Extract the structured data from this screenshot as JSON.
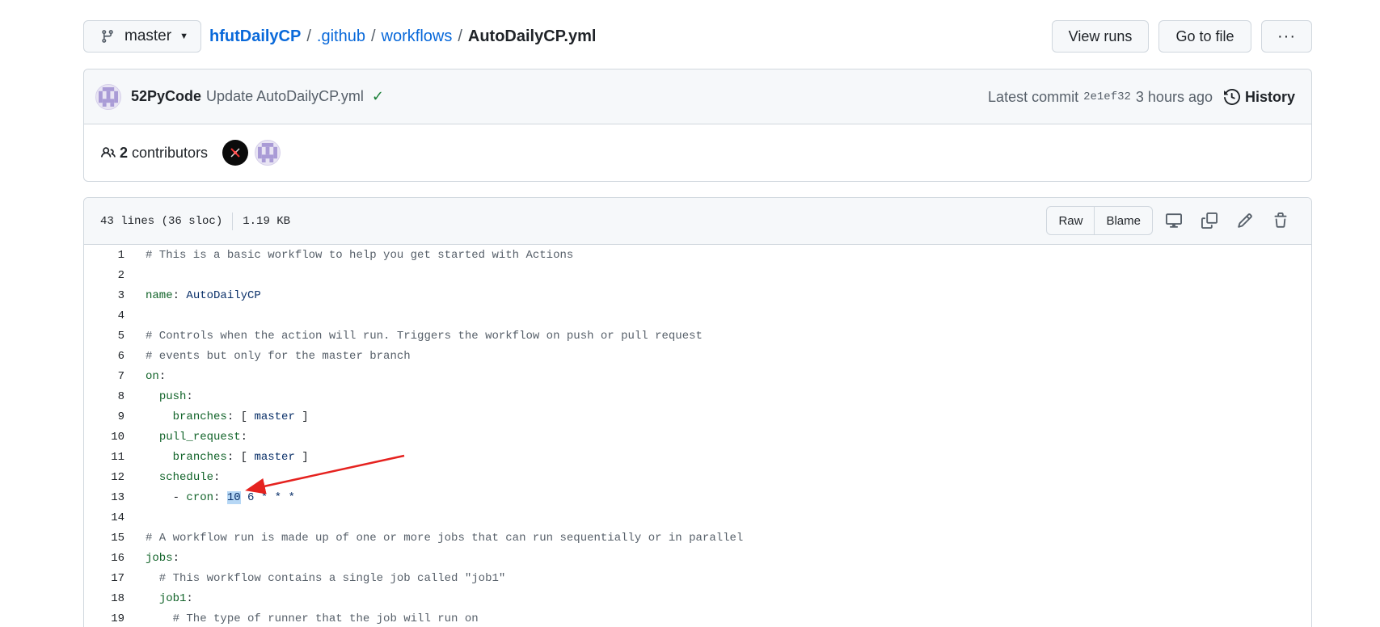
{
  "topbar": {
    "branch": "master",
    "breadcrumb": {
      "repo": "hfutDailyCP",
      "path1": ".github",
      "path2": "workflows",
      "file": "AutoDailyCP.yml",
      "separator": "/"
    },
    "view_runs": "View runs",
    "go_to_file": "Go to file",
    "more": "···"
  },
  "commit": {
    "author": "52PyCode",
    "message": "Update AutoDailyCP.yml",
    "status": "✓",
    "latest_label": "Latest commit",
    "sha": "2e1ef32",
    "time": "3 hours ago",
    "history": "History"
  },
  "contributors": {
    "count": "2",
    "label": "contributors"
  },
  "file": {
    "lines_info": "43 lines (36 sloc)",
    "size": "1.19 KB",
    "raw": "Raw",
    "blame": "Blame"
  },
  "code": [
    {
      "n": "1",
      "parts": [
        {
          "t": "# This is a basic workflow to help you get started with Actions",
          "c": "c-comment"
        }
      ]
    },
    {
      "n": "2",
      "parts": []
    },
    {
      "n": "3",
      "parts": [
        {
          "t": "name",
          "c": "c-key"
        },
        {
          "t": ": ",
          "c": "c-plain"
        },
        {
          "t": "AutoDailyCP",
          "c": "c-val"
        }
      ]
    },
    {
      "n": "4",
      "parts": []
    },
    {
      "n": "5",
      "parts": [
        {
          "t": "# Controls when the action will run. Triggers the workflow on push or pull request",
          "c": "c-comment"
        }
      ]
    },
    {
      "n": "6",
      "parts": [
        {
          "t": "# events but only for the master branch",
          "c": "c-comment"
        }
      ]
    },
    {
      "n": "7",
      "parts": [
        {
          "t": "on",
          "c": "c-key"
        },
        {
          "t": ":",
          "c": "c-plain"
        }
      ]
    },
    {
      "n": "8",
      "parts": [
        {
          "t": "  ",
          "c": "c-plain"
        },
        {
          "t": "push",
          "c": "c-key"
        },
        {
          "t": ":",
          "c": "c-plain"
        }
      ]
    },
    {
      "n": "9",
      "parts": [
        {
          "t": "    ",
          "c": "c-plain"
        },
        {
          "t": "branches",
          "c": "c-key"
        },
        {
          "t": ": [ ",
          "c": "c-plain"
        },
        {
          "t": "master",
          "c": "c-val"
        },
        {
          "t": " ]",
          "c": "c-plain"
        }
      ]
    },
    {
      "n": "10",
      "parts": [
        {
          "t": "  ",
          "c": "c-plain"
        },
        {
          "t": "pull_request",
          "c": "c-key"
        },
        {
          "t": ":",
          "c": "c-plain"
        }
      ]
    },
    {
      "n": "11",
      "parts": [
        {
          "t": "    ",
          "c": "c-plain"
        },
        {
          "t": "branches",
          "c": "c-key"
        },
        {
          "t": ": [ ",
          "c": "c-plain"
        },
        {
          "t": "master",
          "c": "c-val"
        },
        {
          "t": " ]",
          "c": "c-plain"
        }
      ]
    },
    {
      "n": "12",
      "parts": [
        {
          "t": "  ",
          "c": "c-plain"
        },
        {
          "t": "schedule",
          "c": "c-key"
        },
        {
          "t": ":",
          "c": "c-plain"
        }
      ]
    },
    {
      "n": "13",
      "parts": [
        {
          "t": "    - ",
          "c": "c-plain"
        },
        {
          "t": "cron",
          "c": "c-key"
        },
        {
          "t": ": ",
          "c": "c-plain"
        },
        {
          "t": "10",
          "c": "c-val sel"
        },
        {
          "t": " 6 * * *",
          "c": "c-val"
        }
      ]
    },
    {
      "n": "14",
      "parts": []
    },
    {
      "n": "15",
      "parts": [
        {
          "t": "# A workflow run is made up of one or more jobs that can run sequentially or in parallel",
          "c": "c-comment"
        }
      ]
    },
    {
      "n": "16",
      "parts": [
        {
          "t": "jobs",
          "c": "c-key"
        },
        {
          "t": ":",
          "c": "c-plain"
        }
      ]
    },
    {
      "n": "17",
      "parts": [
        {
          "t": "  # This workflow contains a single job called \"job1\"",
          "c": "c-comment"
        }
      ]
    },
    {
      "n": "18",
      "parts": [
        {
          "t": "  ",
          "c": "c-plain"
        },
        {
          "t": "job1",
          "c": "c-key"
        },
        {
          "t": ":",
          "c": "c-plain"
        }
      ]
    },
    {
      "n": "19",
      "parts": [
        {
          "t": "    # The type of runner that the job will run on",
          "c": "c-comment"
        }
      ]
    }
  ],
  "colors": {
    "link": "#0969da",
    "success": "#1a7f37",
    "annotation_arrow": "#e5221f",
    "selection": "#b6d7f5"
  },
  "icons": {
    "branch": "git-branch-icon",
    "history": "history-icon",
    "people": "people-icon",
    "display": "display-icon",
    "copy": "copy-icon",
    "edit": "pencil-icon",
    "delete": "trash-icon"
  }
}
